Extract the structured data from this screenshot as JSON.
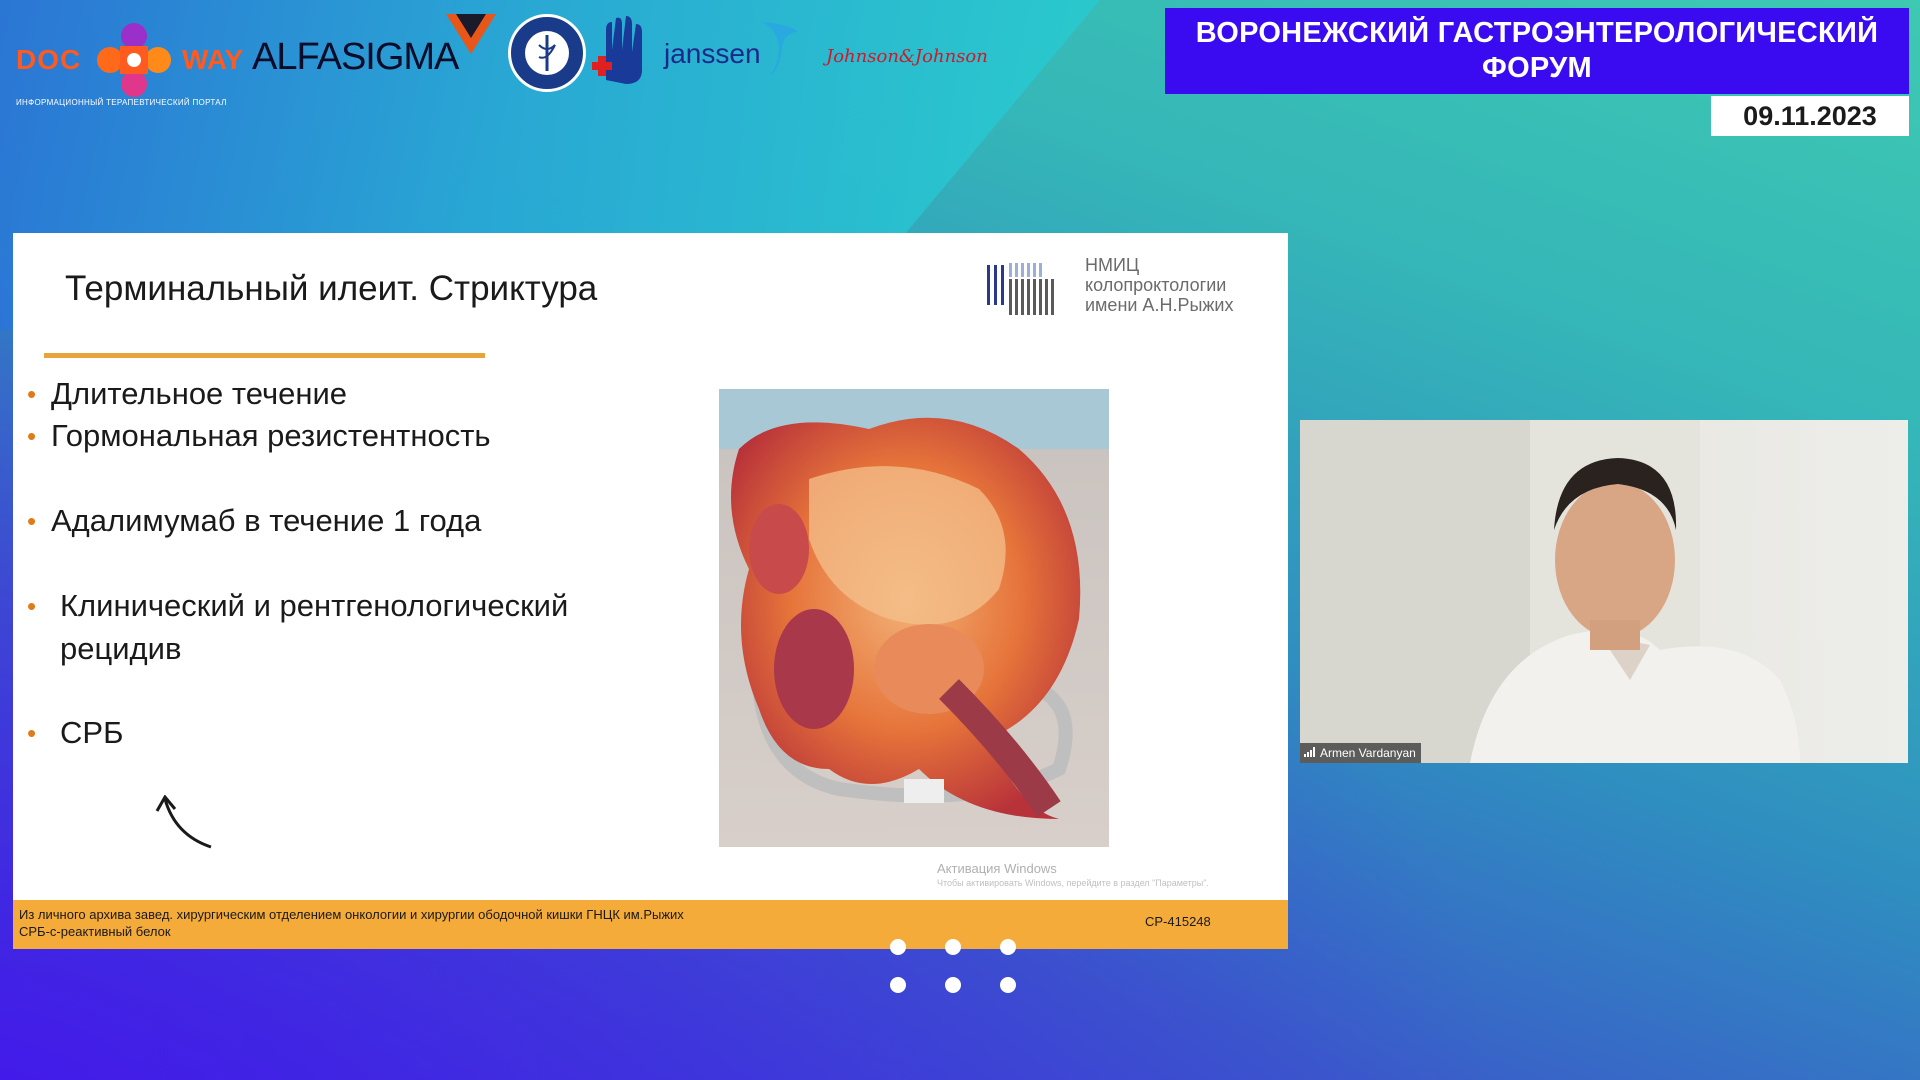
{
  "branding": {
    "docway_doc": "DOC",
    "docway_way": "WAY",
    "docway_tagline": "ИНФОРМАЦИОННЫЙ ТЕРАПЕВТИЧЕСКИЙ ПОРТАЛ",
    "alfasigma": "ALFASIGMA",
    "janssen": "janssen",
    "jj": "Johnson&Johnson"
  },
  "forum": {
    "title_line1": "ВОРОНЕЖСКИЙ ГАСТРОЭНТЕРОЛОГИЧЕСКИЙ",
    "title_line2": "ФОРУМ",
    "date": "09.11.2023"
  },
  "slide": {
    "title": "Терминальный илеит. Стриктура",
    "institute": {
      "line1": "НМИЦ",
      "line2": "колопроктологии",
      "line3": "имени А.Н.Рыжих"
    },
    "bullets": [
      "Длительное течение",
      "Гормональная резистентность",
      "Адалимумаб в течение 1 года",
      "Клинический и рентгенологический",
      "рецидив",
      "СРБ"
    ],
    "windows_activation": "Активация Windows",
    "windows_activation_sub": "Чтобы активировать Windows, перейдите в раздел \"Параметры\".",
    "footer_line1": "Из личного архива завед. хирургическим отделением онкологии и хирургии ободочной кишки ГНЦК им.Рыжих",
    "footer_line2": "СРБ-с-реактивный белок",
    "footer_code": "CP-415248"
  },
  "webcam": {
    "participant_name": "Armen Vardanyan"
  },
  "colors": {
    "forum_bg": "#3a0bf0",
    "footer_bg": "#f4ab3a",
    "accent_rule": "#e8a33a",
    "bullet_dot": "#e07b1a"
  }
}
